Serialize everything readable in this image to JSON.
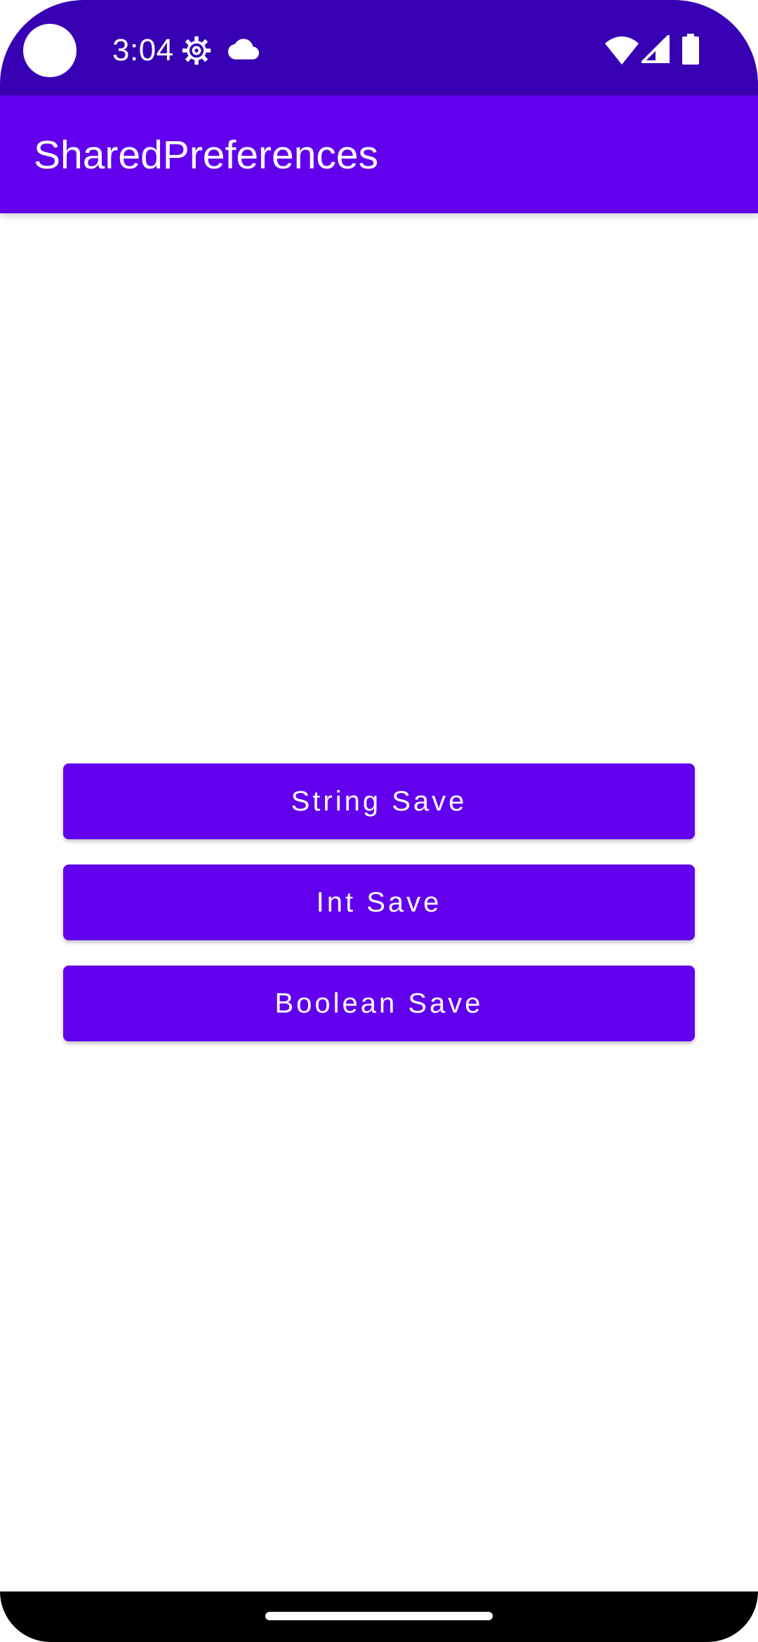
{
  "status_bar": {
    "time": "3:04",
    "icons": [
      "gear-icon",
      "cloud-icon",
      "wifi-icon",
      "signal-icon",
      "battery-icon"
    ],
    "background_color": "#3700b3"
  },
  "app_bar": {
    "title": "SharedPreferences",
    "background_color": "#6200ee"
  },
  "buttons": {
    "string_save": "String Save",
    "int_save": "Int Save",
    "boolean_save": "Boolean Save",
    "background_color": "#6200ee",
    "text_color": "#ffffff"
  },
  "navigation_bar": {
    "background_color": "#000000"
  }
}
